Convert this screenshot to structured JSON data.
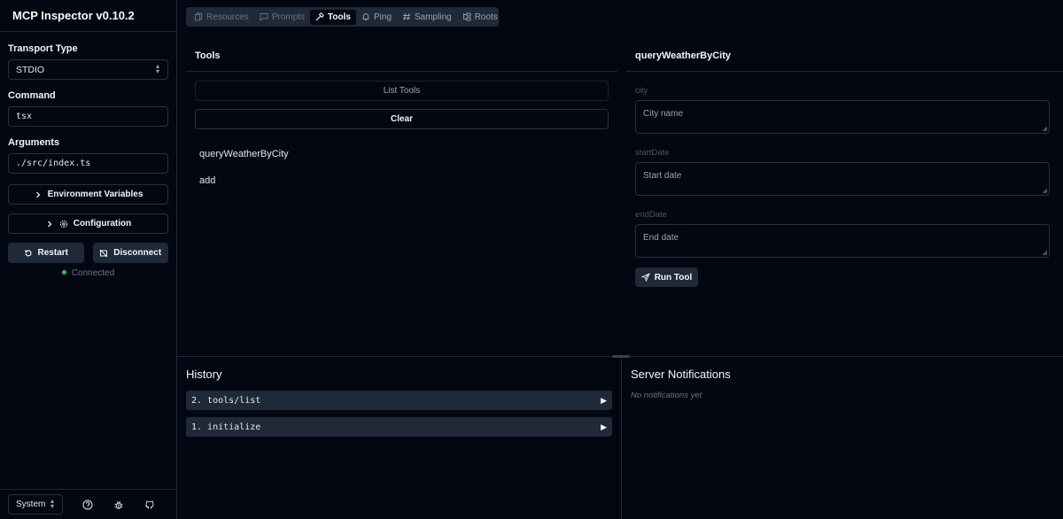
{
  "app": {
    "title": "MCP Inspector v0.10.2"
  },
  "sidebar": {
    "transport_label": "Transport Type",
    "transport_value": "STDIO",
    "command_label": "Command",
    "command_value": "tsx",
    "arguments_label": "Arguments",
    "arguments_value": "./src/index.ts",
    "env_button": "Environment Variables",
    "config_button": "Configuration",
    "restart_button": "Restart",
    "disconnect_button": "Disconnect",
    "status": "Connected",
    "status_color": "#22c55e",
    "theme_value": "System"
  },
  "tabs": [
    {
      "label": "Resources",
      "icon": "files-icon",
      "state": "disabled"
    },
    {
      "label": "Prompts",
      "icon": "message-square-icon",
      "state": "disabled"
    },
    {
      "label": "Tools",
      "icon": "hammer-icon",
      "state": "active"
    },
    {
      "label": "Ping",
      "icon": "bell-icon",
      "state": "enabled"
    },
    {
      "label": "Sampling",
      "icon": "hash-icon",
      "state": "enabled"
    },
    {
      "label": "Roots",
      "icon": "folder-tree-icon",
      "state": "enabled"
    }
  ],
  "tools_panel": {
    "title": "Tools",
    "list_button": "List Tools",
    "clear_button": "Clear",
    "items": [
      "queryWeatherByCity",
      "add"
    ]
  },
  "tool_detail": {
    "title": "queryWeatherByCity",
    "params": [
      {
        "label": "city",
        "placeholder": "City name"
      },
      {
        "label": "startDate",
        "placeholder": "Start date"
      },
      {
        "label": "endDate",
        "placeholder": "End date"
      }
    ],
    "run_button": "Run Tool"
  },
  "history": {
    "title": "History",
    "items": [
      "2. tools/list",
      "1. initialize"
    ]
  },
  "notifications": {
    "title": "Server Notifications",
    "empty": "No notifications yet"
  }
}
